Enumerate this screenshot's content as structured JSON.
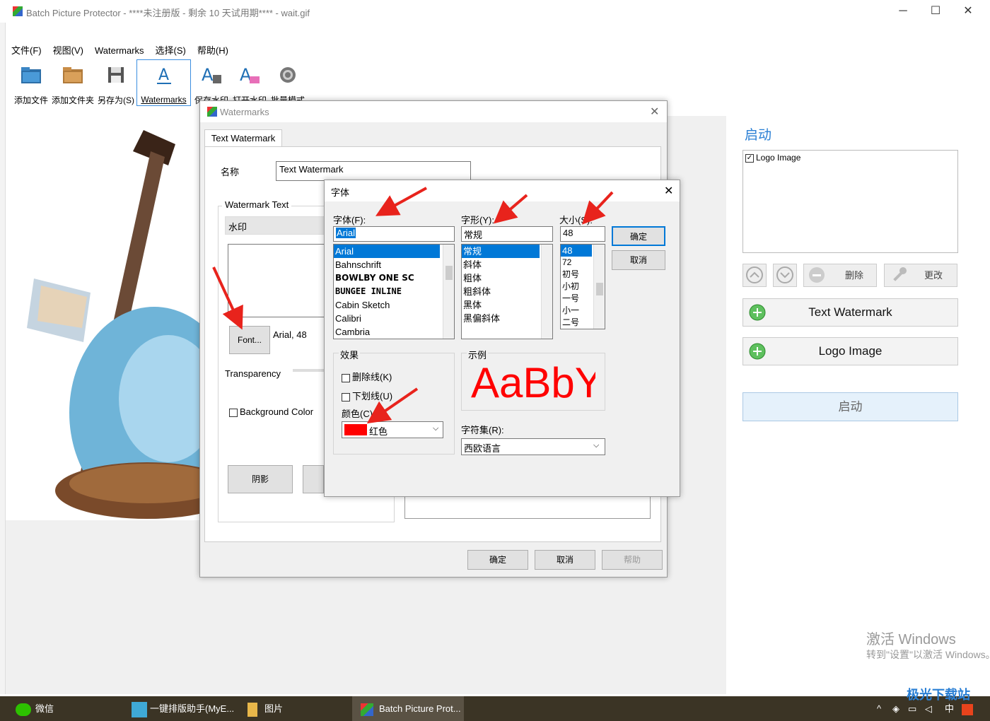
{
  "app": {
    "title": "Batch Picture Protector - ****未注册版 - 剩余 10 天试用期**** - wait.gif"
  },
  "menu": [
    "文件(F)",
    "视图(V)",
    "Watermarks",
    "选择(S)",
    "帮助(H)"
  ],
  "toolbar": [
    "添加文件",
    "添加文件夹",
    "另存为(S)",
    "Watermarks",
    "保存水印",
    "打开水印",
    "批量模式"
  ],
  "wm_dialog": {
    "title": "Watermarks",
    "tab": "Text Watermark",
    "name_label": "名称",
    "name_value": "Text Watermark",
    "group_label": "Watermark Text",
    "text_value": "水印",
    "font_btn": "Font...",
    "font_info": "Arial, 48",
    "transparency": "Transparency",
    "bgcolor": "Background Color",
    "shadow_btn": "阴影",
    "ok": "确定",
    "cancel": "取消",
    "help": "帮助"
  },
  "font_dialog": {
    "title": "字体",
    "font_label": "字体(F):",
    "style_label": "字形(Y):",
    "size_label": "大小(S):",
    "font_value": "Arial",
    "style_value": "常规",
    "size_value": "48",
    "fonts": [
      "Arial",
      "Bahnschrift",
      "BOWLBY ONE SC",
      "BUNGEE INLINE",
      "Cabin Sketch",
      "Calibri",
      "Cambria"
    ],
    "styles": [
      "常规",
      "斜体",
      "粗体",
      "粗斜体",
      "黑体",
      "黑偏斜体"
    ],
    "sizes": [
      "48",
      "72",
      "初号",
      "小初",
      "一号",
      "小一",
      "二号"
    ],
    "ok": "确定",
    "cancel": "取消",
    "effects_label": "效果",
    "strike": "删除线(K)",
    "underline": "下划线(U)",
    "color_label": "颜色(C):",
    "color_value": "红色",
    "color_hex": "#ff0000",
    "sample_label": "示例",
    "sample_text": "AaBbY",
    "charset_label": "字符集(R):",
    "charset_value": "西欧语言"
  },
  "right": {
    "title": "启动",
    "list_item": "Logo Image",
    "delete": "删除",
    "modify": "更改",
    "text_wm": "Text Watermark",
    "logo_img": "Logo Image",
    "start": "启动"
  },
  "activation": {
    "line1": "激活 Windows",
    "line2": "转到\"设置\"以激活 Windows。"
  },
  "taskbar": [
    "微信",
    "一键排版助手(MyE...",
    "图片",
    "Batch Picture Prot..."
  ],
  "tray": {
    "ime": "中",
    "logo": "极光下载站"
  }
}
